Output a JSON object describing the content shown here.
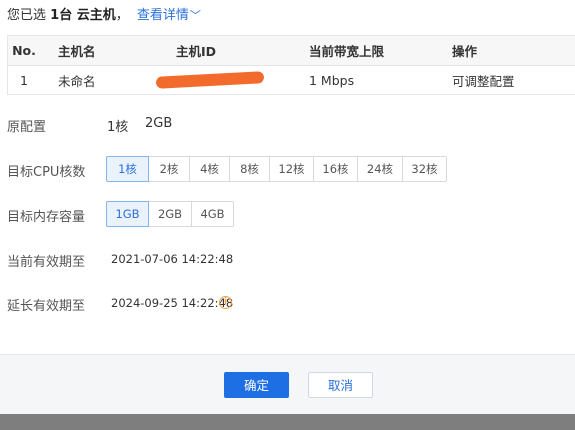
{
  "summary": {
    "prefix": "您已选",
    "count": "1台 云主机",
    "comma": "，",
    "details_link": "查看详情"
  },
  "table": {
    "headers": [
      "No.",
      "主机名",
      "主机ID",
      "当前带宽上限",
      "操作"
    ],
    "rows": [
      {
        "no": "1",
        "name": "未命名",
        "id": "[redacted]",
        "bandwidth": "1 Mbps",
        "action": "可调整配置"
      }
    ]
  },
  "original_config": {
    "label": "原配置",
    "cpu": "1核",
    "memory": "2GB"
  },
  "cpu": {
    "label": "目标CPU核数",
    "options": [
      "1核",
      "2核",
      "4核",
      "8核",
      "12核",
      "16核",
      "24核",
      "32核"
    ],
    "selected": "1核"
  },
  "memory": {
    "label": "目标内存容量",
    "options": [
      "1GB",
      "2GB",
      "4GB"
    ],
    "selected": "1GB"
  },
  "current_expiry": {
    "label": "当前有效期至",
    "value": "2021-07-06 14:22:48"
  },
  "extended_expiry": {
    "label": "延长有效期至",
    "value": "2024-09-25 14:22:48",
    "icon": "info-icon"
  },
  "buttons": {
    "confirm": "确定",
    "cancel": "取消"
  },
  "colors": {
    "primary": "#1e6fe4",
    "link": "#2a6fdb",
    "selected_bg": "#eaf3fc",
    "warning": "#f0a045"
  }
}
